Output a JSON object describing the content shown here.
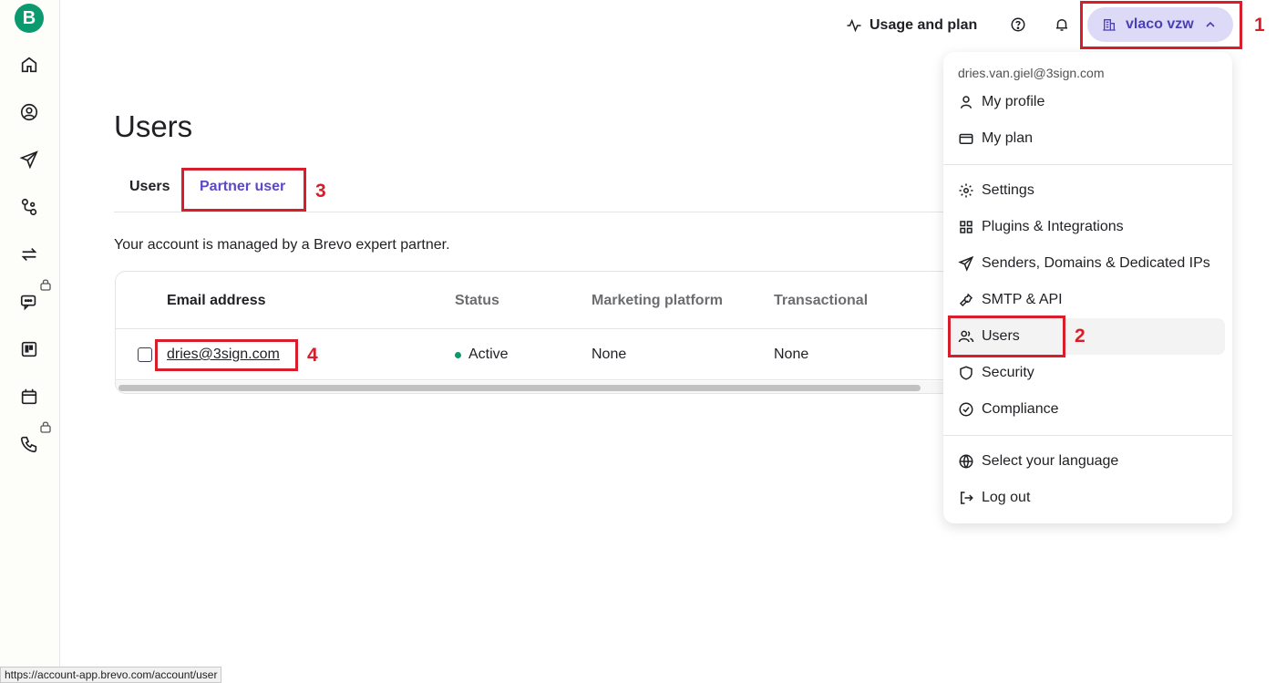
{
  "sidebar": {
    "logo": "B",
    "items": [
      {
        "icon": "home-icon"
      },
      {
        "icon": "contacts-icon"
      },
      {
        "icon": "campaigns-icon"
      },
      {
        "icon": "automations-icon"
      },
      {
        "icon": "transactional-icon"
      },
      {
        "icon": "conversations-icon",
        "locked": true
      },
      {
        "icon": "deals-icon"
      },
      {
        "icon": "meetings-icon"
      },
      {
        "icon": "phone-icon",
        "locked": true
      }
    ]
  },
  "topbar": {
    "usage_label": "Usage and plan",
    "account_name": "vlaco vzw"
  },
  "page": {
    "title": "Users",
    "tabs": [
      "Users",
      "Partner user"
    ],
    "active_tab": "Partner user",
    "info_text": "Your account is managed by a Brevo expert partner."
  },
  "table": {
    "columns": [
      "Email address",
      "Status",
      "Marketing platform",
      "Transactional"
    ],
    "rows": [
      {
        "email": "dries@3sign.com",
        "status": "Active",
        "marketing": "None",
        "transactional": "None"
      }
    ]
  },
  "dropdown": {
    "email": "dries.van.giel@3sign.com",
    "group1": [
      "My profile",
      "My plan"
    ],
    "group2": [
      "Settings",
      "Plugins & Integrations",
      "Senders, Domains & Dedicated IPs",
      "SMTP & API",
      "Users",
      "Security",
      "Compliance"
    ],
    "group3": [
      "Select your language",
      "Log out"
    ]
  },
  "markers": [
    "1",
    "2",
    "3",
    "4"
  ],
  "status_url": "https://account-app.brevo.com/account/user",
  "colors": {
    "brand": "#0b996e",
    "accent": "#5b49c7",
    "highlight": "#d81e2a",
    "account_bg": "#dcdaf7"
  }
}
